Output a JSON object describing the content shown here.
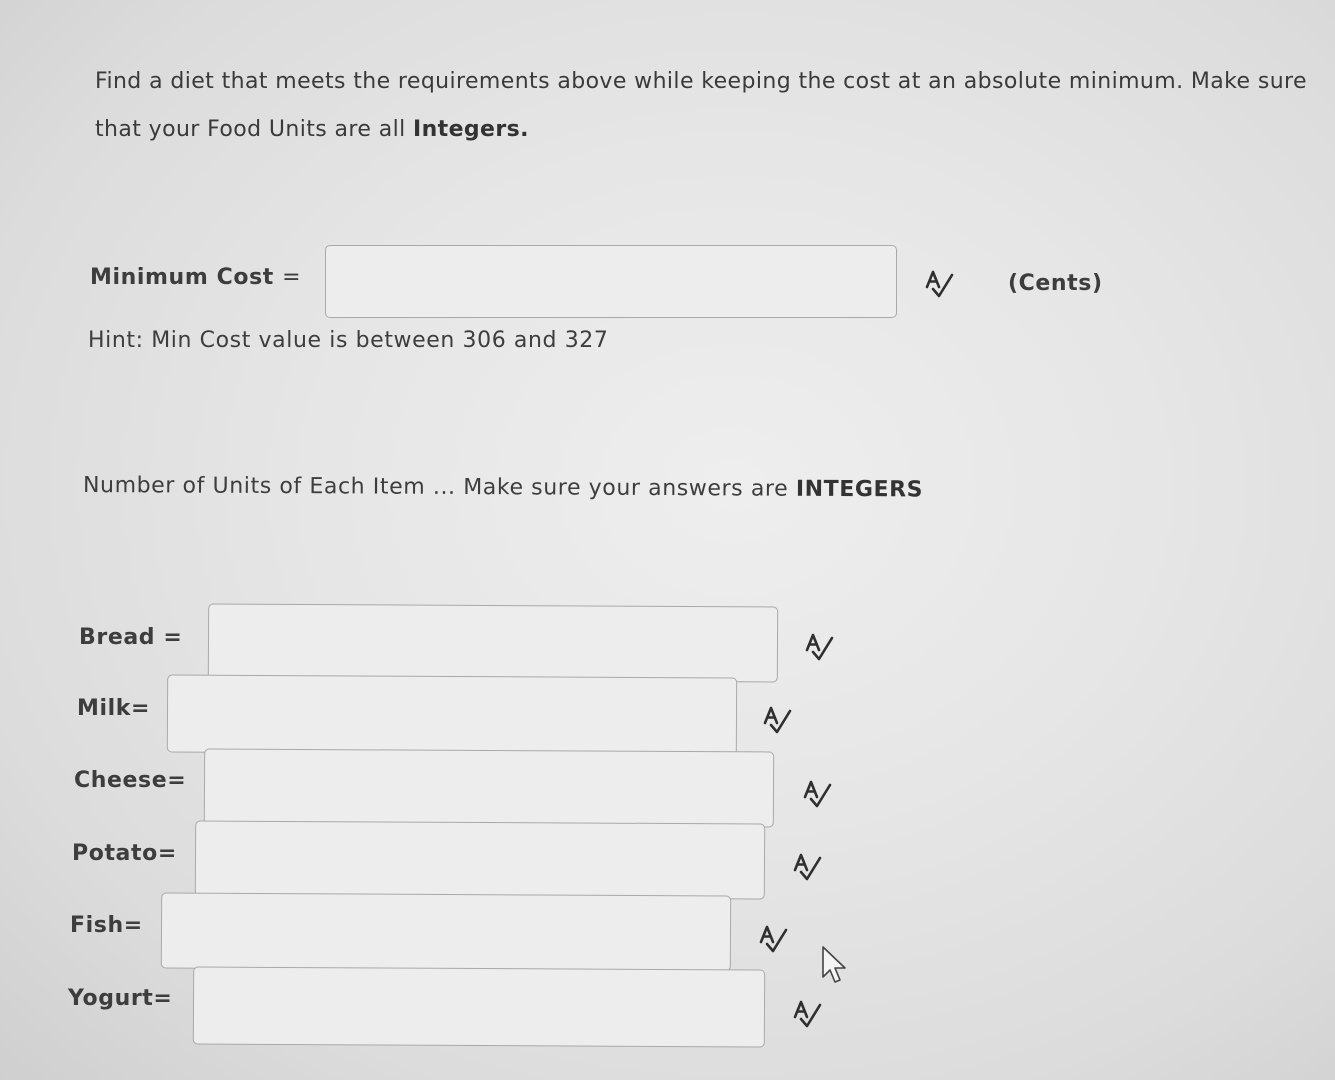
{
  "intro": {
    "part1": "Find a diet that meets the requirements above while keeping the cost at an absolute minimum. Make sure that your Food Units are all ",
    "bold": "Integers."
  },
  "min_cost": {
    "label": "Minimum Cost",
    "equals": "=",
    "value": "",
    "unit": "(Cents)",
    "hint": "Hint: Min Cost value is between 306 and 327"
  },
  "units_heading": {
    "text": "Number of Units of Each Item ... Make sure your answers are ",
    "bold": "INTEGERS"
  },
  "items": [
    {
      "label": "Bread =",
      "value": ""
    },
    {
      "label": "Milk=",
      "value": ""
    },
    {
      "label": "Cheese=",
      "value": ""
    },
    {
      "label": "Potato=",
      "value": ""
    },
    {
      "label": "Fish=",
      "value": ""
    },
    {
      "label": "Yogurt=",
      "value": ""
    }
  ],
  "icons": {
    "spell_check": "spell-check-icon",
    "cursor": "mouse-pointer-icon"
  }
}
